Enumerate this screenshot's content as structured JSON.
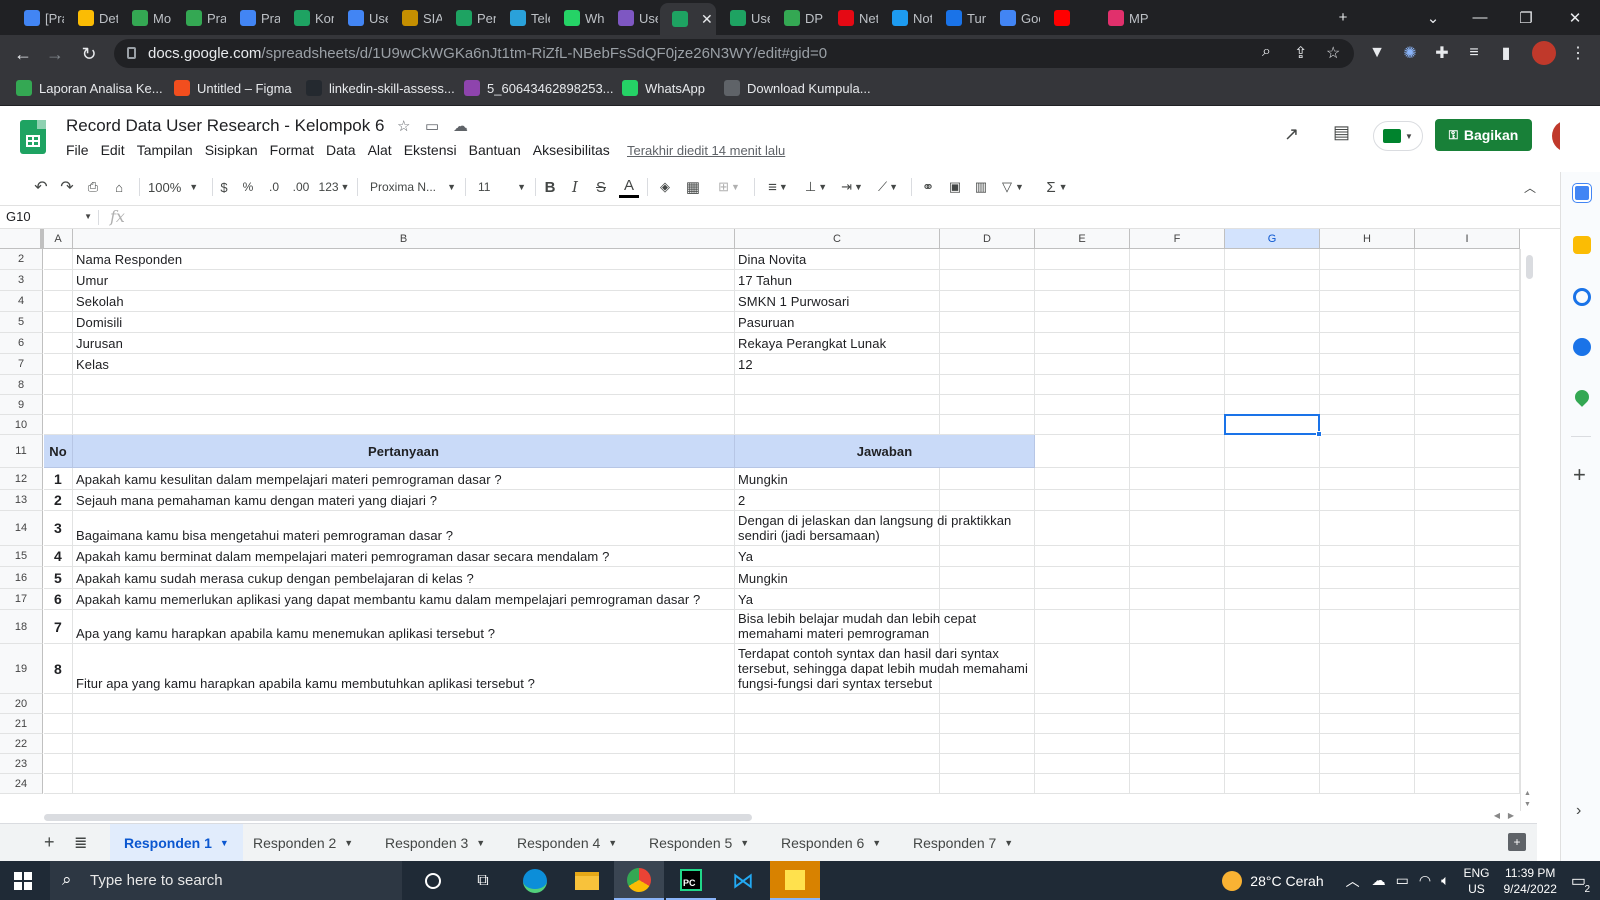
{
  "browser": {
    "tabs": [
      {
        "label": "[Pra",
        "color": "#4285f4"
      },
      {
        "label": "Det",
        "color": "#fbbc04"
      },
      {
        "label": "Mo",
        "color": "#34a853"
      },
      {
        "label": "Pra",
        "color": "#34a853"
      },
      {
        "label": "Pra",
        "color": "#4285f4"
      },
      {
        "label": "Kon",
        "color": "#1ea362"
      },
      {
        "label": "Use",
        "color": "#4285f4"
      },
      {
        "label": "SIA",
        "color": "#c58f00"
      },
      {
        "label": "Pen",
        "color": "#1ea362"
      },
      {
        "label": "Tele",
        "color": "#2aa1da"
      },
      {
        "label": "Wh",
        "color": "#25d366"
      },
      {
        "label": "Use",
        "color": "#7e57c2"
      },
      {
        "label": "",
        "color": "#1ea362",
        "active": true
      },
      {
        "label": "Use",
        "color": "#1ea362"
      },
      {
        "label": "DPE",
        "color": "#34a853"
      },
      {
        "label": "Net",
        "color": "#e50914"
      },
      {
        "label": "Not",
        "color": "#1d9bf0"
      },
      {
        "label": "Turi",
        "color": "#1a73e8"
      },
      {
        "label": "Goo",
        "color": "#4285f4"
      },
      {
        "label": "",
        "color": "#ff0000"
      },
      {
        "label": "MP",
        "color": "#e1306c"
      }
    ],
    "url_host": "docs.google.com",
    "url_path": "/spreadsheets/d/1U9wCkWGKa6nJt1tm-RiZfL-NBebFsSdQF0jze26N3WY/edit#gid=0",
    "bookmarks": [
      {
        "label": "Laporan Analisa Ke...",
        "color": "#34a853"
      },
      {
        "label": "Untitled – Figma",
        "color": "#f24e1e"
      },
      {
        "label": "linkedin-skill-assess...",
        "color": "#24292f"
      },
      {
        "label": "5_60643462898253...",
        "color": "#8e44ad"
      },
      {
        "label": "WhatsApp",
        "color": "#25d366"
      },
      {
        "label": "Download Kumpula...",
        "color": "#5f6368"
      }
    ]
  },
  "sheets": {
    "title": "Record Data User Research - Kelompok 6",
    "menu": [
      "File",
      "Edit",
      "Tampilan",
      "Sisipkan",
      "Format",
      "Data",
      "Alat",
      "Ekstensi",
      "Bantuan",
      "Aksesibilitas"
    ],
    "last_edit": "Terakhir diedit 14 menit lalu",
    "share_label": "Bagikan",
    "toolbar": {
      "zoom": "100%",
      "currency": "$",
      "percent": "%",
      "dec_less": ".0",
      "dec_more": ".00",
      "format": "123",
      "font": "Proxima N...",
      "font_size": "11"
    },
    "name_box": "G10",
    "fx": "fx"
  },
  "grid": {
    "columns": [
      "A",
      "B",
      "C",
      "D",
      "E",
      "F",
      "G",
      "H",
      "I"
    ],
    "selected_column": "G",
    "row_numbers": [
      "2",
      "3",
      "4",
      "5",
      "6",
      "7",
      "8",
      "9",
      "10",
      "11",
      "12",
      "13",
      "14",
      "15",
      "16",
      "17",
      "18",
      "19",
      "20",
      "21",
      "22",
      "23",
      "24"
    ],
    "info": [
      {
        "label": "Nama Responden",
        "value": "Dina Novita"
      },
      {
        "label": "Umur",
        "value": " 17 Tahun"
      },
      {
        "label": "Sekolah",
        "value": "SMKN 1 Purwosari"
      },
      {
        "label": "Domisili",
        "value": "Pasuruan"
      },
      {
        "label": "Jurusan",
        "value": "Rekaya Perangkat Lunak"
      },
      {
        "label": "Kelas",
        "value": "12"
      }
    ],
    "table_header": {
      "no": "No",
      "question": "Pertanyaan",
      "answer": "Jawaban"
    },
    "qa": [
      {
        "no": "1",
        "q": "Apakah kamu kesulitan dalam mempelajari materi pemrograman dasar ?",
        "a": "Mungkin"
      },
      {
        "no": "2",
        "q": "Sejauh mana pemahaman kamu dengan materi yang diajari ?",
        "a": "2"
      },
      {
        "no": "3",
        "q": "Bagaimana kamu bisa mengetahui materi pemrograman dasar ?",
        "a": "Dengan di jelaskan dan langsung di praktikkan sendiri (jadi bersamaan)"
      },
      {
        "no": "4",
        "q": "Apakah kamu berminat dalam mempelajari materi pemrograman dasar secara mendalam ?",
        "a": "Ya"
      },
      {
        "no": "5",
        "q": "Apakah kamu sudah merasa cukup dengan pembelajaran di kelas ?",
        "a": "Mungkin"
      },
      {
        "no": "6",
        "q": "Apakah kamu memerlukan aplikasi yang dapat membantu kamu dalam mempelajari pemrograman dasar ?",
        "a": "Ya"
      },
      {
        "no": "7",
        "q": "Apa yang kamu harapkan apabila kamu menemukan aplikasi tersebut ?",
        "a": "Bisa lebih belajar mudah dan lebih cepat memahami materi pemrograman"
      },
      {
        "no": "8",
        "q": "Fitur apa yang kamu harapkan apabila kamu membutuhkan aplikasi tersebut ?",
        "a": "Terdapat contoh syntax dan hasil dari syntax tersebut, sehingga dapat lebih mudah memahami fungsi-fungsi dari syntax tersebut"
      }
    ]
  },
  "sheet_tabs": [
    "Responden 1",
    "Responden 2",
    "Responden 3",
    "Responden 4",
    "Responden 5",
    "Responden 6",
    "Responden 7"
  ],
  "taskbar": {
    "search_placeholder": "Type here to search",
    "weather": "28°C  Cerah",
    "lang": "ENG",
    "region": "US",
    "time": "11:39 PM",
    "date": "9/24/2022",
    "notifications": "2"
  }
}
